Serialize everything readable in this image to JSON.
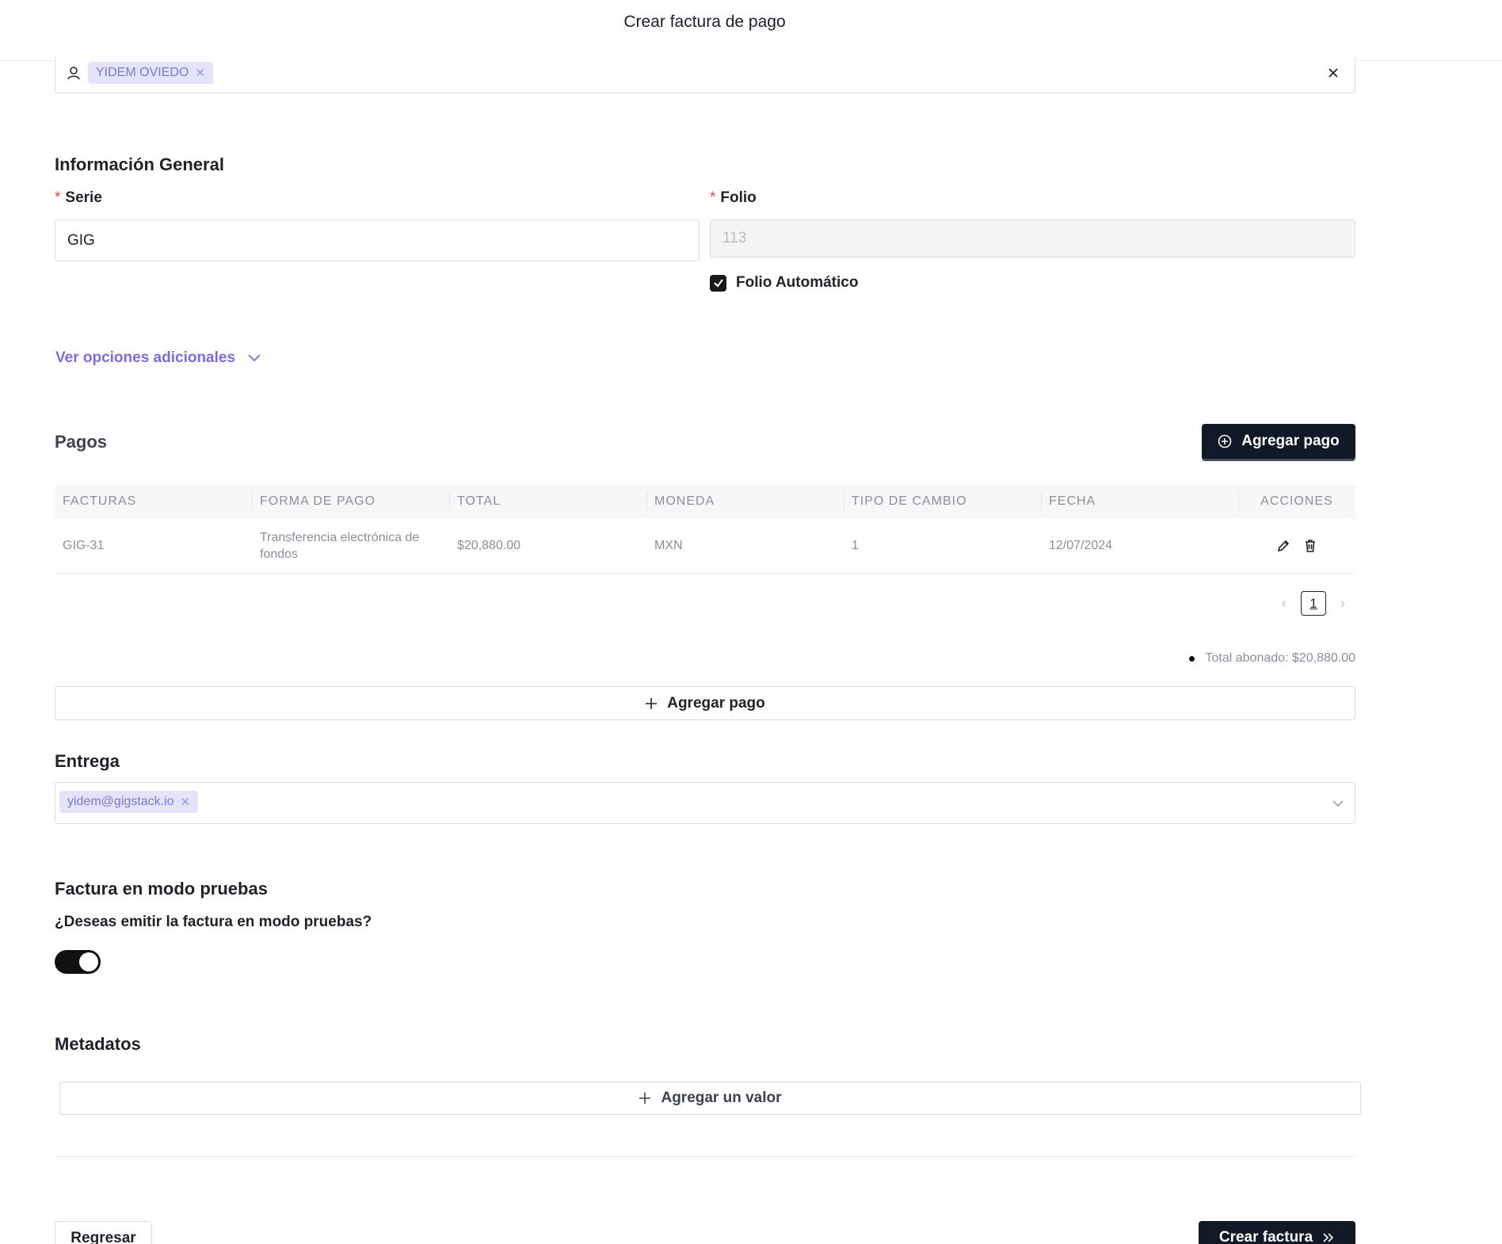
{
  "header": {
    "title": "Crear factura de pago"
  },
  "client": {
    "tag": "YIDEM OVIEDO"
  },
  "general": {
    "title": "Información General",
    "serie_label": "Serie",
    "serie_value": "GIG",
    "folio_label": "Folio",
    "folio_value": "113",
    "auto_folio_label": "Folio Automático",
    "more_options": "Ver opciones adicionales"
  },
  "payments": {
    "title": "Pagos",
    "add_button": "Agregar pago",
    "columns": [
      "FACTURAS",
      "FORMA DE PAGO",
      "TOTAL",
      "MONEDA",
      "TIPO DE CAMBIO",
      "FECHA",
      "ACCIONES"
    ],
    "rows": [
      {
        "factura": "GIG-31",
        "forma": "Transferencia electrónica de fondos",
        "total": "$20,880.00",
        "moneda": "MXN",
        "tipo_cambio": "1",
        "fecha": "12/07/2024"
      }
    ],
    "page": "1",
    "total_text": "Total abonado: $20,880.00",
    "add_outline": "Agregar pago"
  },
  "delivery": {
    "title": "Entrega",
    "email": "yidem@gigstack.io"
  },
  "test_mode": {
    "title": "Factura en modo pruebas",
    "question": "¿Deseas emitir la factura en modo pruebas?",
    "enabled": true
  },
  "metadata": {
    "title": "Metadatos",
    "add_value": "Agregar un valor"
  },
  "footer": {
    "back": "Regresar",
    "create": "Crear factura"
  }
}
